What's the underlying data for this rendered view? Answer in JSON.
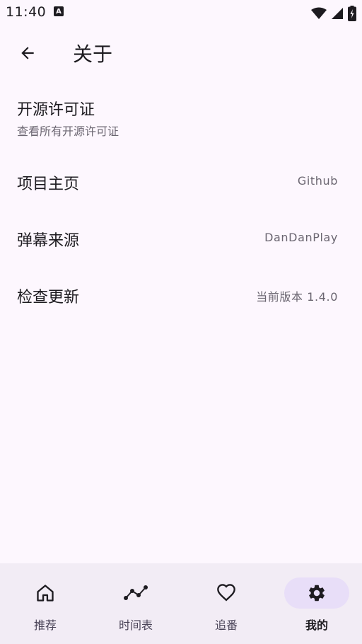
{
  "status_bar": {
    "time": "11:40",
    "badge": "A",
    "icons": [
      "wifi-icon",
      "cell-signal-icon",
      "battery-charging-icon"
    ]
  },
  "app_bar": {
    "back_icon": "arrow-back-icon",
    "title": "关于"
  },
  "settings": [
    {
      "title": "开源许可证",
      "subtitle": "查看所有开源许可证",
      "value": ""
    },
    {
      "title": "项目主页",
      "subtitle": "",
      "value": "Github"
    },
    {
      "title": "弹幕来源",
      "subtitle": "",
      "value": "DanDanPlay"
    },
    {
      "title": "检查更新",
      "subtitle": "",
      "value": "当前版本 1.4.0"
    }
  ],
  "bottom_nav": {
    "items": [
      {
        "label": "推荐",
        "icon": "home-icon",
        "active": false
      },
      {
        "label": "时间表",
        "icon": "timeline-icon",
        "active": false
      },
      {
        "label": "追番",
        "icon": "heart-icon",
        "active": false
      },
      {
        "label": "我的",
        "icon": "settings-gear-icon",
        "active": true
      }
    ]
  },
  "colors": {
    "background": "#fdf7fe",
    "nav_background": "#f2ecf5",
    "active_indicator": "#e8def8",
    "text_primary": "#1d1b20",
    "text_secondary": "#6b6671"
  }
}
